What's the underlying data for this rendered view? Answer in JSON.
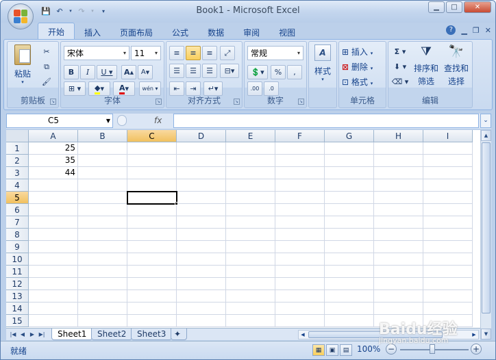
{
  "app": {
    "title": "Book1 - Microsoft Excel"
  },
  "ribbon": {
    "tabs": [
      "开始",
      "插入",
      "页面布局",
      "公式",
      "数据",
      "审阅",
      "视图"
    ],
    "clipboard": {
      "paste": "粘贴",
      "label": "剪贴板"
    },
    "font": {
      "name": "宋体",
      "size": "11",
      "label": "字体"
    },
    "alignment": {
      "label": "对齐方式"
    },
    "number": {
      "format": "常规",
      "label": "数字"
    },
    "styles": {
      "button": "样式"
    },
    "cells": {
      "insert": "插入",
      "delete": "删除",
      "format": "格式",
      "label": "单元格"
    },
    "editing": {
      "sort_filter": "排序和",
      "sort_filter2": "筛选",
      "find_select": "查找和",
      "find_select2": "选择",
      "label": "编辑"
    }
  },
  "formula_bar": {
    "name_box": "C5",
    "fx": "fx",
    "value": ""
  },
  "sheet": {
    "columns": [
      "A",
      "B",
      "C",
      "D",
      "E",
      "F",
      "G",
      "H",
      "I"
    ],
    "rows": [
      "1",
      "2",
      "3",
      "4",
      "5",
      "6",
      "7",
      "8",
      "9",
      "10",
      "11",
      "12",
      "13",
      "14",
      "15"
    ],
    "selected_cell": "C5",
    "cells": {
      "A1": "25",
      "A2": "35",
      "A3": "44"
    }
  },
  "sheet_tabs": [
    "Sheet1",
    "Sheet2",
    "Sheet3"
  ],
  "status": {
    "left": "就绪",
    "zoom": "100%"
  },
  "watermark": {
    "main": "Baidu经验",
    "sub": "jingyan.baidu.com"
  }
}
